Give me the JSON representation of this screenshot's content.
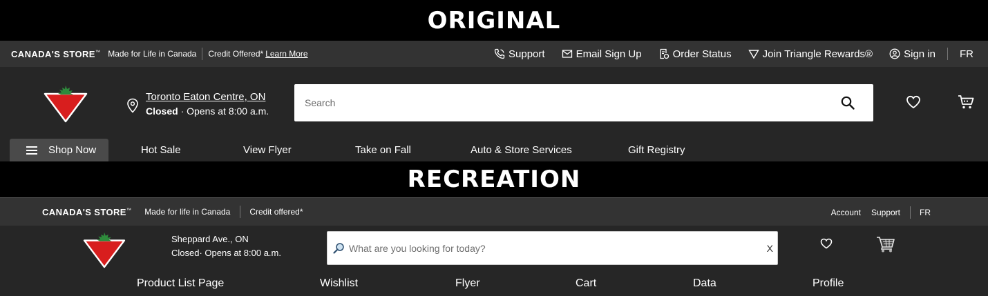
{
  "banners": {
    "original": "ORIGINAL",
    "recreation": "RECREATION"
  },
  "original": {
    "utility": {
      "brand": "CANADA'S STORE",
      "brand_mark": "™",
      "tagline": "Made for Life in Canada",
      "credit": "Credit Offered*",
      "learn_more": "Learn More",
      "links": {
        "support": "Support",
        "email": "Email Sign Up",
        "order": "Order Status",
        "rewards": "Join Triangle Rewards®",
        "signin": "Sign in",
        "lang": "FR"
      }
    },
    "store": {
      "name": "Toronto Eaton Centre, ON",
      "status": "Closed",
      "hours": " · Opens at 8:00 a.m."
    },
    "search": {
      "placeholder": "Search"
    },
    "nav": {
      "shop_now": "Shop Now",
      "hot_sale": "Hot Sale",
      "flyer": "View Flyer",
      "fall": "Take on Fall",
      "auto": "Auto & Store Services",
      "gift": "Gift Registry"
    }
  },
  "recreation": {
    "utility": {
      "brand": "CANADA'S STORE",
      "brand_mark": "™",
      "tagline": "Made for life in Canada",
      "credit": "Credit offered*",
      "account": "Account",
      "support": "Support",
      "lang": "FR"
    },
    "store": {
      "name": "Sheppard Ave., ON",
      "status": "Closed· Opens at 8:00 a.m."
    },
    "search": {
      "placeholder": "What are you looking for today?",
      "clear": "X"
    },
    "nav": {
      "plp": "Product List Page",
      "wishlist": "Wishlist",
      "flyer": "Flyer",
      "cart": "Cart",
      "data": "Data",
      "profile": "Profile"
    }
  },
  "colors": {
    "bg_dark": "#262626",
    "bar": "#333333",
    "brand_red": "#d81e1e",
    "leaf_green": "#2e8b3c",
    "shop_tab": "#4a4a4a"
  }
}
